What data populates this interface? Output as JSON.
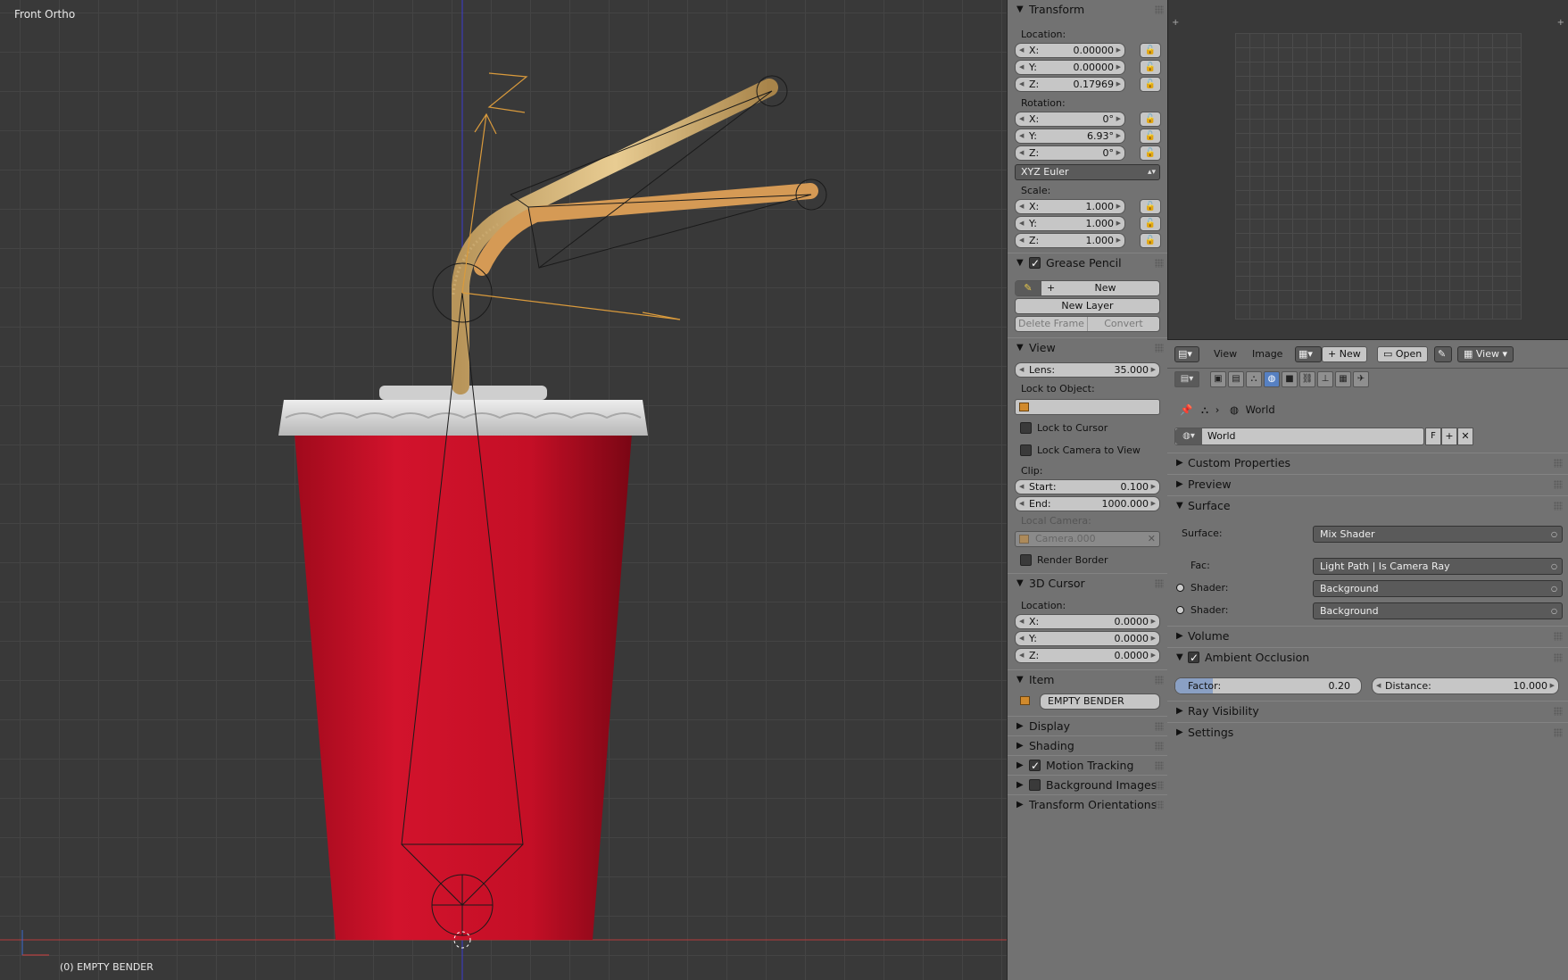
{
  "viewport": {
    "view_name": "Front Ortho",
    "object_info": "(0) EMPTY BENDER"
  },
  "npanel": {
    "transform": {
      "title": "Transform",
      "location_label": "Location:",
      "location": [
        {
          "axis": "X:",
          "value": "0.00000"
        },
        {
          "axis": "Y:",
          "value": "0.00000"
        },
        {
          "axis": "Z:",
          "value": "0.17969"
        }
      ],
      "rotation_label": "Rotation:",
      "rotation": [
        {
          "axis": "X:",
          "value": "0°"
        },
        {
          "axis": "Y:",
          "value": "6.93°"
        },
        {
          "axis": "Z:",
          "value": "0°"
        }
      ],
      "rotation_mode": "XYZ Euler",
      "scale_label": "Scale:",
      "scale": [
        {
          "axis": "X:",
          "value": "1.000"
        },
        {
          "axis": "Y:",
          "value": "1.000"
        },
        {
          "axis": "Z:",
          "value": "1.000"
        }
      ]
    },
    "grease_pencil": {
      "title": "Grease Pencil",
      "new_label": "New",
      "new_layer_label": "New Layer",
      "delete_frame_label": "Delete Frame",
      "convert_label": "Convert"
    },
    "view": {
      "title": "View",
      "lens_label": "Lens:",
      "lens_value": "35.000",
      "lock_to_object_label": "Lock to Object:",
      "lock_to_cursor_label": "Lock to Cursor",
      "lock_camera_label": "Lock Camera to View",
      "clip_label": "Clip:",
      "clip_start_label": "Start:",
      "clip_start": "0.100",
      "clip_end_label": "End:",
      "clip_end": "1000.000",
      "local_camera_label": "Local Camera:",
      "local_camera": "Camera.000",
      "render_border_label": "Render Border"
    },
    "cursor": {
      "title": "3D Cursor",
      "location_label": "Location:",
      "location": [
        {
          "axis": "X:",
          "value": "0.0000"
        },
        {
          "axis": "Y:",
          "value": "0.0000"
        },
        {
          "axis": "Z:",
          "value": "0.0000"
        }
      ]
    },
    "item": {
      "title": "Item",
      "name": "EMPTY BENDER"
    },
    "collapsed": [
      "Display",
      "Shading",
      "Motion Tracking",
      "Background Images",
      "Transform Orientations"
    ]
  },
  "image_editor": {
    "menu_view": "View",
    "menu_image": "Image",
    "new_label": "New",
    "open_label": "Open",
    "view_label": "View"
  },
  "properties": {
    "breadcrumb": "World",
    "world_name": "World",
    "f_label": "F",
    "sections": {
      "custom_properties": "Custom Properties",
      "preview": "Preview",
      "surface": "Surface",
      "volume": "Volume",
      "ambient_occlusion": "Ambient Occlusion",
      "ray_visibility": "Ray Visibility",
      "settings": "Settings"
    },
    "surface": {
      "surface_label": "Surface:",
      "surface_value": "Mix Shader",
      "fac_label": "Fac:",
      "fac_value": "Light Path | Is Camera Ray",
      "shader1_label": "Shader:",
      "shader1_value": "Background",
      "shader2_label": "Shader:",
      "shader2_value": "Background"
    },
    "ao": {
      "factor_label": "Factor:",
      "factor_value": "0.20",
      "factor_fraction": 0.2,
      "distance_label": "Distance:",
      "distance_value": "10.000"
    }
  }
}
